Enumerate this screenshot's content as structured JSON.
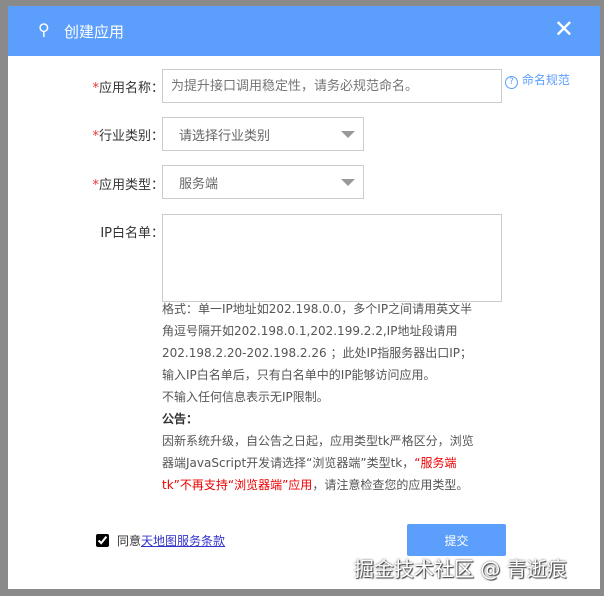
{
  "dialog": {
    "title": "创建应用",
    "close": "✕"
  },
  "form": {
    "name": {
      "label": "应用名称：",
      "required": "*",
      "placeholder": "为提升接口调用稳定性，请务必规范命名。"
    },
    "help": {
      "icon": "?",
      "label": "命名规范"
    },
    "industry": {
      "label": "行业类别：",
      "required": "*",
      "value": "请选择行业类别"
    },
    "type": {
      "label": "应用类型：",
      "required": "*",
      "value": "服务端"
    },
    "ip": {
      "label": "IP白名单："
    }
  },
  "notes": {
    "format": "格式：单一IP地址如202.198.0.0，多个IP之间请用英文半角逗号隔开如202.198.0.1,202.199.2.2,IP地址段请用202.198.2.20-202.198.2.26 ；此处IP指服务器出口IP；输入IP白名单后，只有白名单中的IP能够访问应用。",
    "noip": "不输入任何信息表示无IP限制。",
    "notice_title": "公告：",
    "notice_a": "因新系统升级，自公告之日起，应用类型tk严格区分，浏览器端JavaScript开发请选择“浏览器端”类型tk，",
    "notice_red": "“服务端tk”不再支持“浏览器端”应用",
    "notice_b": "，请注意检查您的应用类型。"
  },
  "agree": {
    "prefix": "同意",
    "link": "天地图服务条款",
    "checked": true
  },
  "submit": "提交",
  "watermark": "掘金技术社区 @ 青逝痕"
}
